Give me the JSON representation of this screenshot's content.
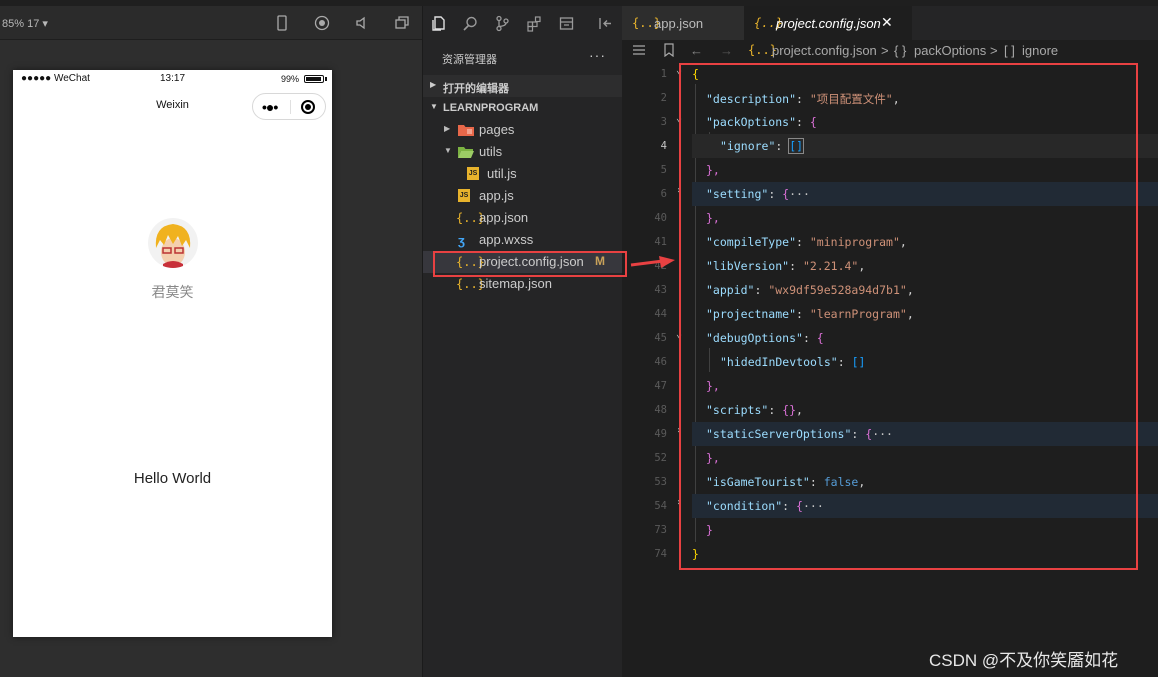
{
  "simulator": {
    "zoom": "85% 17 ▾",
    "status": {
      "signal": "●●●●● WeChat",
      "time": "13:17",
      "battery": "99%"
    },
    "nav_title": "Weixin",
    "nickname": "君莫笑",
    "hello": "Hello World"
  },
  "explorer": {
    "title": "资源管理器",
    "more": "···",
    "open_editors": "打开的编辑器",
    "project": "LEARNPROGRAM",
    "tree": [
      {
        "name": "pages"
      },
      {
        "name": "utils"
      },
      {
        "name": "util.js"
      },
      {
        "name": "app.js"
      },
      {
        "name": "app.json"
      },
      {
        "name": "app.wxss"
      },
      {
        "name": "project.config.json",
        "status": "M"
      },
      {
        "name": "sitemap.json"
      }
    ]
  },
  "editor": {
    "tabs": [
      {
        "icon": "{..}",
        "label": "app.json"
      },
      {
        "icon": "{..}",
        "label": "project.config.json",
        "close": "✕"
      }
    ],
    "breadcrumb": [
      "{..}",
      "project.config.json",
      ">",
      "{ }",
      "packOptions",
      ">",
      "[ ]",
      "ignore"
    ],
    "lines": [
      {
        "num": "1",
        "text": "{"
      },
      {
        "num": "2",
        "key": "\"description\"",
        "value": "\"项目配置文件\""
      },
      {
        "num": "3",
        "key": "\"packOptions\"",
        "open": "{"
      },
      {
        "num": "4",
        "key": "\"ignore\"",
        "open": "[]"
      },
      {
        "num": "5",
        "text": "},"
      },
      {
        "num": "6",
        "key": "\"setting\"",
        "open": "{",
        "ellipsis": "···"
      },
      {
        "num": "40",
        "text": "},"
      },
      {
        "num": "41",
        "key": "\"compileType\"",
        "value": "\"miniprogram\""
      },
      {
        "num": "42",
        "key": "\"libVersion\"",
        "value": "\"2.21.4\""
      },
      {
        "num": "43",
        "key": "\"appid\"",
        "value": "\"wx9df59e528a94d7b1\""
      },
      {
        "num": "44",
        "key": "\"projectname\"",
        "value": "\"learnProgram\""
      },
      {
        "num": "45",
        "key": "\"debugOptions\"",
        "open": "{"
      },
      {
        "num": "46",
        "key": "\"hidedInDevtools\"",
        "open": "[]"
      },
      {
        "num": "47",
        "text": "},"
      },
      {
        "num": "48",
        "key": "\"scripts\"",
        "open": "{}"
      },
      {
        "num": "49",
        "key": "\"staticServerOptions\"",
        "open": "{",
        "ellipsis": "···"
      },
      {
        "num": "52",
        "text": "},"
      },
      {
        "num": "53",
        "key": "\"isGameTourist\"",
        "value": "false"
      },
      {
        "num": "54",
        "key": "\"condition\"",
        "open": "{",
        "ellipsis": "···"
      },
      {
        "num": "73",
        "text": "}"
      },
      {
        "num": "74",
        "text": "}"
      }
    ]
  },
  "watermark": "CSDN @不及你笑靥如花",
  "colors": {
    "highlight": "#e84142",
    "accent": "#e8b32c",
    "string": "#ce9178",
    "key": "#9cdcfe"
  }
}
